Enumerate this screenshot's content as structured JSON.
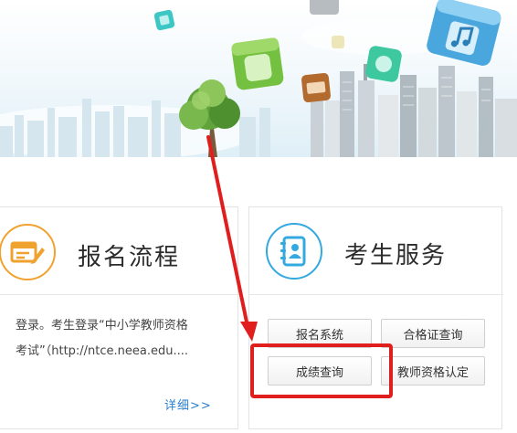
{
  "left_card": {
    "title": "报名流程",
    "icon": "form-pen-icon",
    "desc_line1": "登录。考生登录“中小学教师资格",
    "desc_line2": "考试”（http://ntce.neea.edu....",
    "more_label": "详细>>"
  },
  "right_card": {
    "title": "考生服务",
    "icon": "contact-book-icon",
    "buttons": [
      {
        "label": "报名系统"
      },
      {
        "label": "合格证查询"
      },
      {
        "label": "成绩查询"
      },
      {
        "label": "教师资格认定"
      }
    ]
  },
  "colors": {
    "accent_orange": "#f0a22e",
    "accent_blue": "#33a9e0",
    "link_blue": "#2a7fcc",
    "annotation_red": "#e11e1e"
  }
}
